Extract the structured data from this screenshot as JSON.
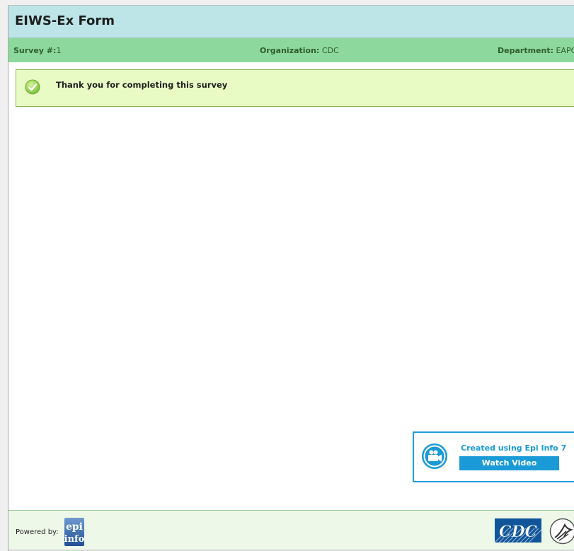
{
  "form": {
    "title": "EIWS-Ex Form"
  },
  "info_bar": {
    "survey_label": "Survey #:",
    "survey_value": "1",
    "organization_label": "Organization:",
    "organization_value": "CDC",
    "department_label": "Department:",
    "department_value": "EAPC"
  },
  "message": {
    "icon": "check-circle-icon",
    "text": "Thank you for completing this survey"
  },
  "promo": {
    "icon": "video-camera-icon",
    "title": "Created using Epi Info 7",
    "button_label": "Watch Video"
  },
  "footer": {
    "powered_by": "Powered by:",
    "epi_logo_text_top": "epi",
    "epi_logo_text_bottom": "info",
    "cdc_logo_text": "CDC"
  },
  "colors": {
    "title_bar": "#bde5e8",
    "info_bar": "#8dd89d",
    "success_bg": "#e9fbc5",
    "accent_blue": "#1a9ad6"
  }
}
